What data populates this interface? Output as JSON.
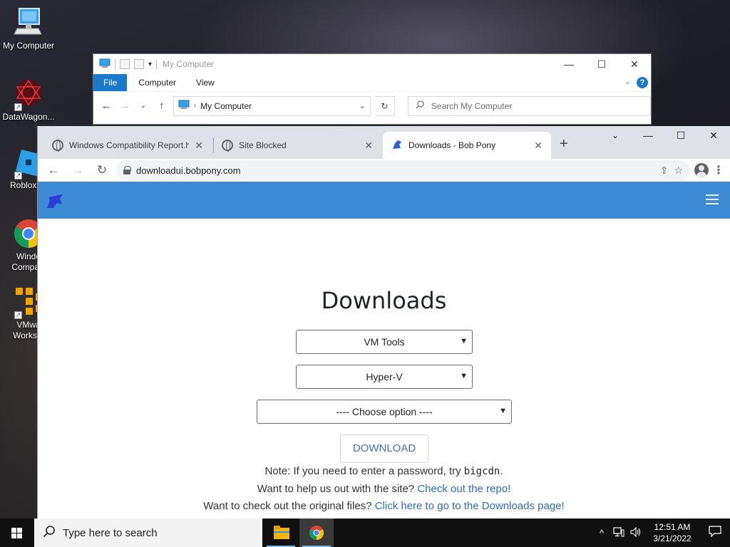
{
  "desktop": {
    "icons": [
      {
        "label": "My Computer"
      },
      {
        "label": "DataWagon..."
      },
      {
        "label": "Roblox St"
      },
      {
        "label": "Windo\nCompatil"
      },
      {
        "label": "VMwa\nWorksta"
      }
    ]
  },
  "explorer": {
    "title": "My Computer",
    "ribbon_tabs": [
      "File",
      "Computer",
      "View"
    ],
    "address": "My Computer",
    "search_placeholder": "Search My Computer",
    "help": "?"
  },
  "chrome": {
    "tabs": [
      {
        "title": "Windows Compatibility Report.h",
        "active": false
      },
      {
        "title": "Site Blocked",
        "active": false
      },
      {
        "title": "Downloads - Bob Pony",
        "active": true
      }
    ],
    "url": "downloadui.bobpony.com"
  },
  "page": {
    "heading": "Downloads",
    "select_category": "VM Tools",
    "select_platform": "Hyper-V",
    "select_option": "---- Choose option ----",
    "download_button": "DOWNLOAD",
    "note_password_prefix": "Note: If you need to enter a password, try ",
    "note_password_code": "bigcdn",
    "note_password_suffix": ".",
    "help_prefix": "Want to help us out with the site? ",
    "help_link": "Check out the repo!",
    "files_prefix": "Want to check out the original files? ",
    "files_link": "Click here to go to the Downloads page!"
  },
  "taskbar": {
    "search_placeholder": "Type here to search",
    "time": "12:51 AM",
    "date": "3/21/2022"
  },
  "colors": {
    "site_nav": "#3d8bd4",
    "link": "#2f6db5",
    "explorer_file_tab": "#1979ca",
    "taskbar": "#101010"
  }
}
